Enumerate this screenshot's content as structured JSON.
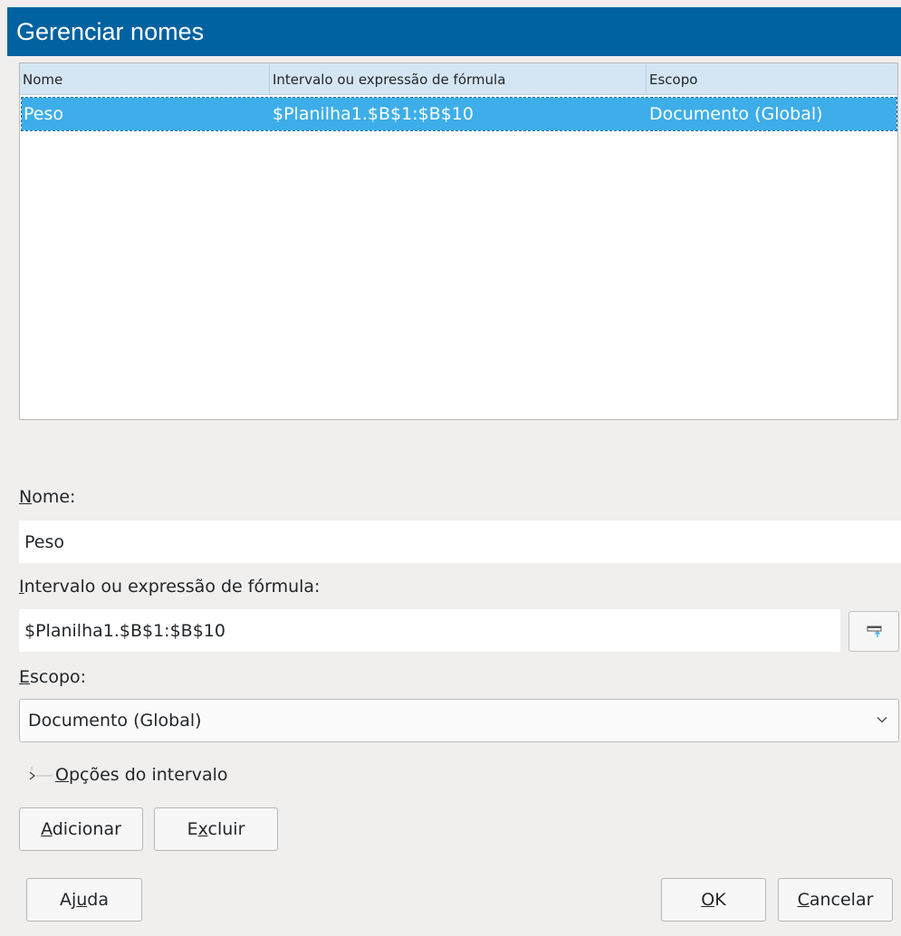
{
  "window": {
    "title": "Gerenciar nomes"
  },
  "list": {
    "columns": [
      "Nome",
      "Intervalo ou expressão de fórmula",
      "Escopo"
    ],
    "rows": [
      {
        "name": "Peso",
        "range": "$Planilha1.$B$1:$B$10",
        "scope": "Documento (Global)"
      }
    ]
  },
  "form": {
    "name_label": {
      "mnemonic": "N",
      "rest": "ome:"
    },
    "name_value": "Peso",
    "range_label": {
      "mnemonic": "I",
      "rest": "ntervalo ou expressão de fórmula:"
    },
    "range_value": "$Planilha1.$B$1:$B$10",
    "scope_label": {
      "mnemonic": "E",
      "rest": "scopo:"
    },
    "scope_value": "Documento (Global)",
    "range_options": {
      "mnemonic": "O",
      "rest": "pções do intervalo"
    }
  },
  "buttons": {
    "add": {
      "mnemonic": "A",
      "rest": "dicionar"
    },
    "delete": {
      "pre": "E",
      "mnemonic": "x",
      "rest": "cluir"
    },
    "help": {
      "pre": "Aj",
      "mnemonic": "u",
      "rest": "da"
    },
    "ok": {
      "mnemonic": "O",
      "rest": "K"
    },
    "cancel": {
      "mnemonic": "C",
      "rest": "ancelar"
    }
  },
  "icons": {
    "shrink": "shrink-dialog-icon",
    "dropdown": "chevron-down-icon",
    "expander": "expander-arrow-icon"
  },
  "colors": {
    "titlebar": "#0062a0",
    "selection": "#3daee9",
    "header": "#d4e6f3"
  }
}
